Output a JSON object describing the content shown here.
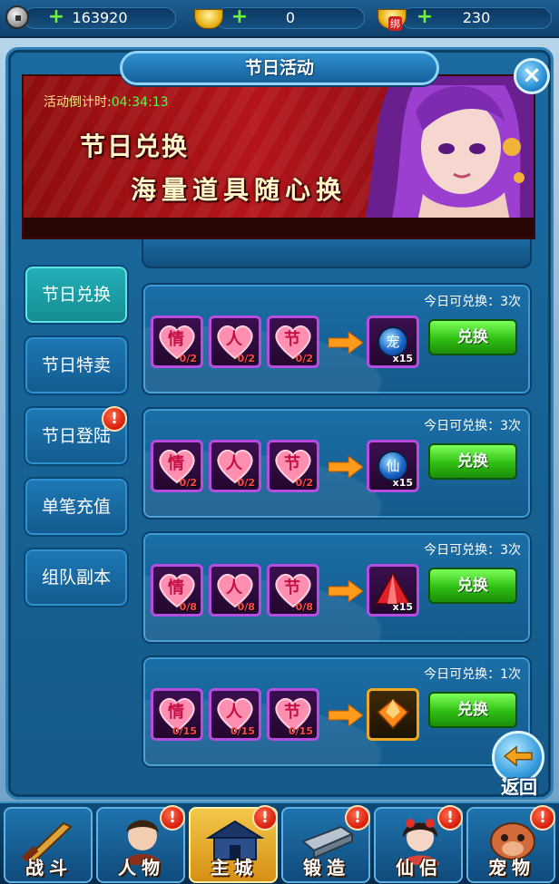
{
  "resources": {
    "coins": "163920",
    "gold": "0",
    "bound_gold": "230",
    "bound_tag": "绑"
  },
  "window": {
    "title": "节日活动"
  },
  "banner": {
    "countdown_label": "活动倒计时:",
    "countdown_value": "04:34:13",
    "headline_1": "节日兑换",
    "headline_2": "海量道具随心换"
  },
  "tabs": [
    {
      "label": "节日兑换",
      "active": true
    },
    {
      "label": "节日特卖",
      "active": false
    },
    {
      "label": "节日登陆",
      "active": false,
      "badge": "!"
    },
    {
      "label": "单笔充值",
      "active": false
    },
    {
      "label": "组队副本",
      "active": false
    }
  ],
  "exchanges": [
    {
      "limit": "今日可兑换：3次",
      "inputs": [
        {
          "char": "情",
          "count": "0/2"
        },
        {
          "char": "人",
          "count": "0/2"
        },
        {
          "char": "节",
          "count": "0/2"
        }
      ],
      "reward": {
        "icon": "pet-orb-icon",
        "char": "宠",
        "qty": "x15"
      },
      "button": "兑换"
    },
    {
      "limit": "今日可兑换：3次",
      "inputs": [
        {
          "char": "情",
          "count": "0/2"
        },
        {
          "char": "人",
          "count": "0/2"
        },
        {
          "char": "节",
          "count": "0/2"
        }
      ],
      "reward": {
        "icon": "immortal-orb-icon",
        "char": "仙",
        "qty": "x15"
      },
      "button": "兑换"
    },
    {
      "limit": "今日可兑换：3次",
      "inputs": [
        {
          "char": "情",
          "count": "0/8"
        },
        {
          "char": "人",
          "count": "0/8"
        },
        {
          "char": "节",
          "count": "0/8"
        }
      ],
      "reward": {
        "icon": "red-crystal-icon",
        "char": "",
        "qty": "x15"
      },
      "button": "兑换"
    },
    {
      "limit": "今日可兑换：1次",
      "inputs": [
        {
          "char": "情",
          "count": "0/15"
        },
        {
          "char": "人",
          "count": "0/15"
        },
        {
          "char": "节",
          "count": "0/15"
        }
      ],
      "reward": {
        "icon": "orange-gem-icon",
        "char": "",
        "qty": ""
      },
      "button": "兑换"
    }
  ],
  "return_button": "返回",
  "bottom_nav": [
    {
      "label": "战斗",
      "icon": "sword-icon",
      "active": false,
      "badge": ""
    },
    {
      "label": "人物",
      "icon": "hero-portrait-icon",
      "active": false,
      "badge": "!"
    },
    {
      "label": "主城",
      "icon": "city-gate-icon",
      "active": true,
      "badge": "!"
    },
    {
      "label": "锻造",
      "icon": "forge-icon",
      "active": false,
      "badge": "!"
    },
    {
      "label": "仙侣",
      "icon": "companion-portrait-icon",
      "active": false,
      "badge": "!"
    },
    {
      "label": "宠物",
      "icon": "pet-portrait-icon",
      "active": false,
      "badge": "!"
    }
  ],
  "colors": {
    "accent_green": "#2fbf14",
    "countdown_green": "#4cff4c",
    "badge_red": "#d61b0b",
    "item_frame_purple": "#b54de0"
  }
}
